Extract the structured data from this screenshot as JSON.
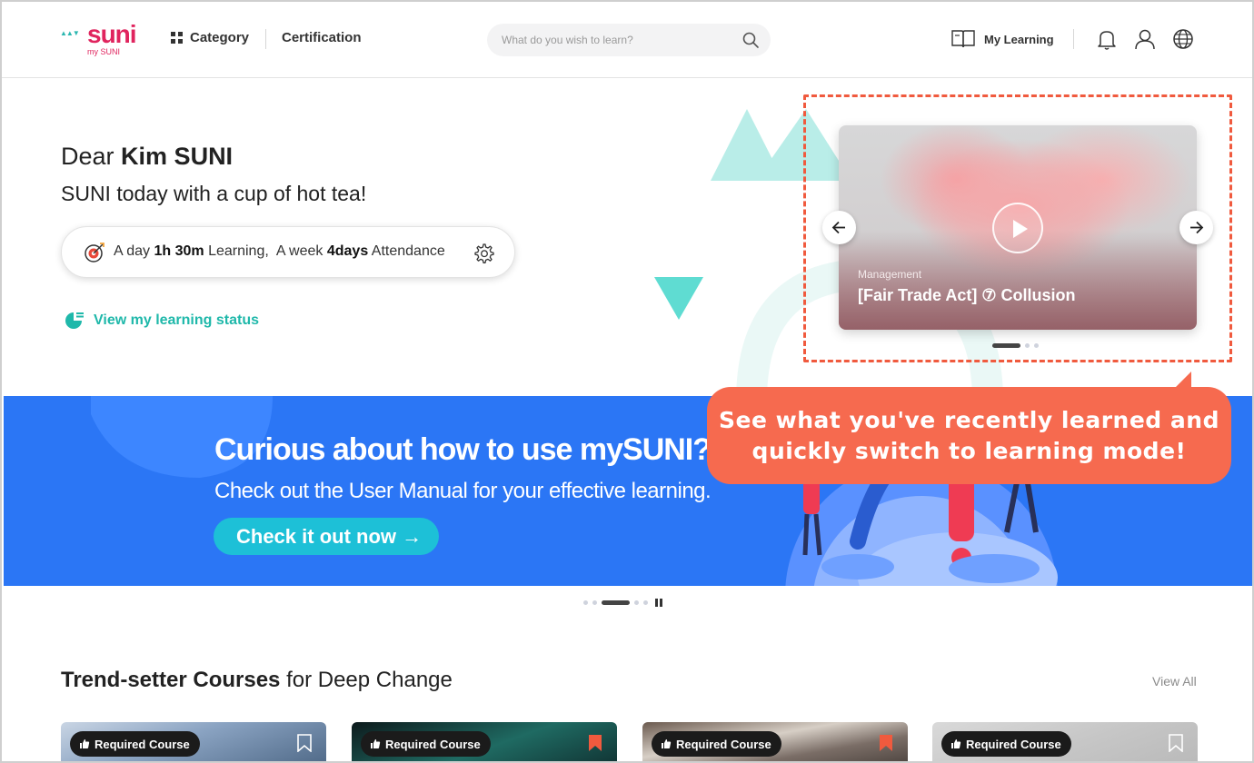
{
  "header": {
    "logo_word": "suni",
    "logo_sub": "my SUNI",
    "category_label": "Category",
    "certification_label": "Certification",
    "search_placeholder": "What do you wish to learn?",
    "my_learning_label": "My Learning",
    "icons": [
      "book-icon",
      "bell-icon",
      "user-icon",
      "globe-icon",
      "search-icon",
      "grid-icon"
    ]
  },
  "hero": {
    "greeting_prefix": "Dear",
    "user_name": "Kim SUNI",
    "subtitle": "SUNI today with a cup of hot tea!",
    "stats": {
      "day_prefix": "A day",
      "day_value": "1h 30m",
      "day_suffix": "Learning,",
      "week_prefix": "A week",
      "week_value": "4days",
      "week_suffix": "Attendance"
    },
    "view_status_label": "View my learning status"
  },
  "recent_card": {
    "category": "Management",
    "title": "[Fair Trade Act] ⑦ Collusion",
    "slides_total": 3,
    "active_slide": 1
  },
  "tooltip": {
    "line1": "See what you've recently learned and",
    "line2": "quickly switch to learning mode!",
    "color": "#f66a4f"
  },
  "banner": {
    "headline": "Curious about how to use mySUNI?",
    "subline": "Check out the User Manual for your effective learning.",
    "cta_label": "Check it out now →",
    "background": "#2b76f5",
    "slides_total": 5,
    "active_slide": 3
  },
  "section": {
    "title_bold": "Trend-setter Courses",
    "title_rest": " for Deep Change",
    "view_all_label": "View All",
    "cards": [
      {
        "badge": "Required Course",
        "bookmarked": false
      },
      {
        "badge": "Required Course",
        "bookmarked": true
      },
      {
        "badge": "Required Course",
        "bookmarked": true
      },
      {
        "badge": "Required Course",
        "bookmarked": false
      }
    ]
  },
  "colors": {
    "brand": "#e0245e",
    "teal": "#1fb8aa",
    "dashed_outline": "#f05a3e"
  }
}
